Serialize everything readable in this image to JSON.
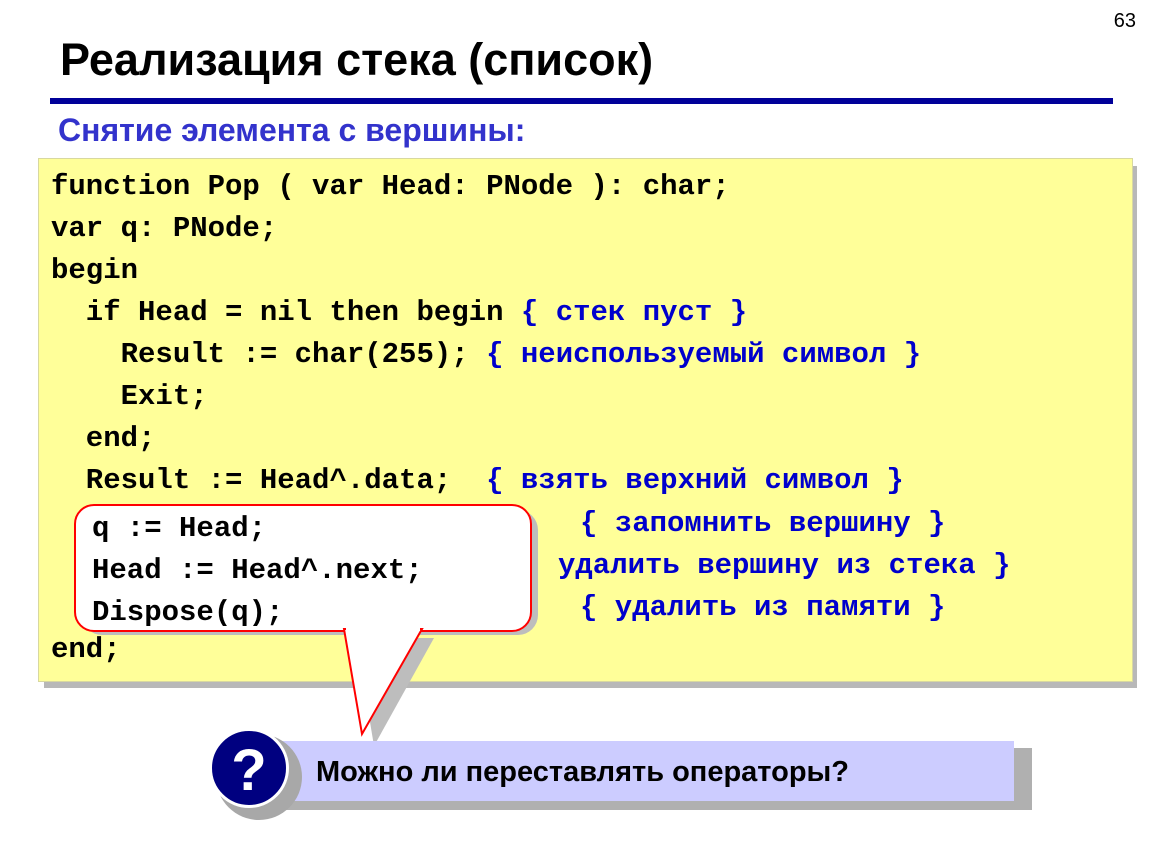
{
  "slide_number": "63",
  "title": "Реализация стека (список)",
  "subtitle": "Снятие элемента с вершины:",
  "code": {
    "line1": "function Pop ( var Head: PNode ): char;",
    "line2": "var q: PNode;",
    "line3": "begin",
    "line4_code": "  if Head = nil then begin ",
    "line4_comment": "{ стек пуст }",
    "line5_code": "    Result := char(255); ",
    "line5_comment": "{ неиспользуемый символ }",
    "line6": "    Exit;",
    "line7": "  end;",
    "line8_code": "  Result := Head^.data;  ",
    "line8_comment": "{ взять верхний символ }",
    "line9_comment": "{ запомнить вершину }",
    "line10_comment": "удалить вершину из стека }",
    "line11_comment": "{ удалить из памяти }",
    "line12": "end;"
  },
  "callout": {
    "line1": "q := Head;",
    "line2": "Head := Head^.next;",
    "line3": "Dispose(q);"
  },
  "question": {
    "icon_glyph": "?",
    "text": "Можно ли переставлять операторы?"
  },
  "colors": {
    "accent": "#000099",
    "subtitle": "#3333cc",
    "comment": "#0000cc",
    "code_bg": "#ffff99",
    "callout_border": "#ff0000",
    "question_bg": "#ccccff",
    "question_icon": "#000080"
  }
}
